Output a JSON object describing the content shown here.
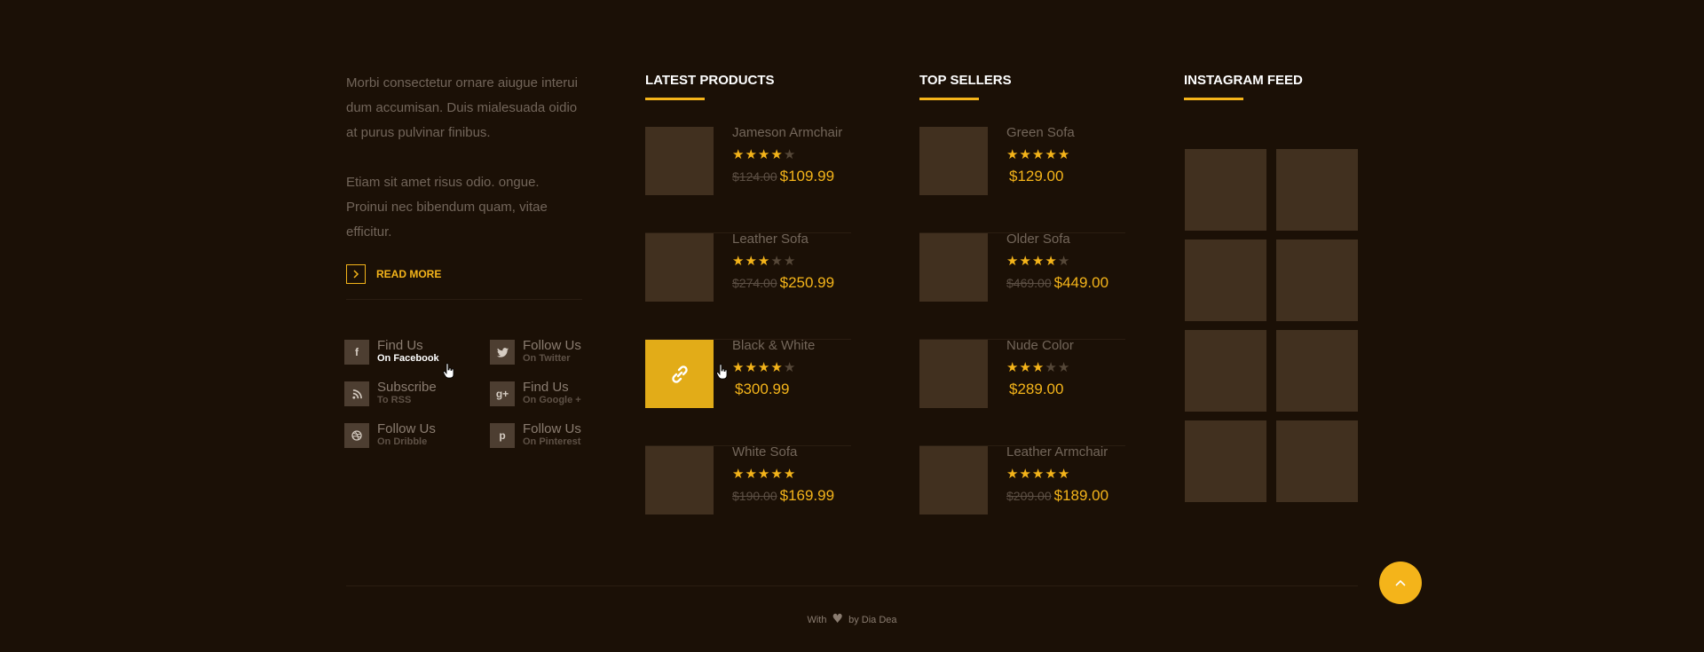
{
  "about": {
    "paragraph1": "Morbi consectetur ornare aiugue interui dum accumisan. Duis mialesuada oidio at purus pulvinar finibus.",
    "paragraph2": "Etiam sit amet risus odio. ongue. Proinui nec bibendum quam, vitae efficitur.",
    "read_more_label": "READ MORE",
    "read_more_icon": "chevron-right-icon"
  },
  "socials": [
    {
      "name": "facebook",
      "line1": "Find Us",
      "line2": "On Facebook",
      "icon": "facebook-icon",
      "glyph": "f"
    },
    {
      "name": "twitter",
      "line1": "Follow Us",
      "line2": "On Twitter",
      "icon": "twitter-icon",
      "glyph": ""
    },
    {
      "name": "rss",
      "line1": "Subscribe",
      "line2": "To RSS",
      "icon": "rss-icon",
      "glyph": ""
    },
    {
      "name": "google-plus",
      "line1": "Find Us",
      "line2": "On Google +",
      "icon": "google-plus-icon",
      "glyph": "g+"
    },
    {
      "name": "dribbble",
      "line1": "Follow Us",
      "line2": "On Dribble",
      "icon": "dribbble-icon",
      "glyph": ""
    },
    {
      "name": "pinterest",
      "line1": "Follow Us",
      "line2": "On Pinterest",
      "icon": "pinterest-icon",
      "glyph": "p"
    }
  ],
  "latest_products": {
    "title": "LATEST PRODUCTS",
    "items": [
      {
        "name": "Jameson Armchair",
        "rating": 4,
        "old_price": "$124.00",
        "price": "$109.99"
      },
      {
        "name": "Leather Sofa",
        "rating": 3,
        "old_price": "$274.00",
        "price": "$250.99"
      },
      {
        "name": "Black & White",
        "rating": 4,
        "old_price": "",
        "price": "$300.99",
        "hover_icon": "link-icon"
      },
      {
        "name": "White Sofa",
        "rating": 5,
        "old_price": "$190.00",
        "price": "$169.99"
      }
    ]
  },
  "top_sellers": {
    "title": "TOP SELLERS",
    "items": [
      {
        "name": "Green Sofa",
        "rating": 5,
        "old_price": "",
        "price": "$129.00"
      },
      {
        "name": "Older Sofa",
        "rating": 4,
        "old_price": "$469.00",
        "price": "$449.00"
      },
      {
        "name": "Nude Color",
        "rating": 3,
        "old_price": "",
        "price": "$289.00"
      },
      {
        "name": "Leather Armchair",
        "rating": 5,
        "old_price": "$209.00",
        "price": "$189.00"
      }
    ]
  },
  "instagram": {
    "title": "INSTAGRAM FEED",
    "tile_count": 8
  },
  "footer": {
    "credit_prefix": "With",
    "credit_icon": "heart-icon",
    "credit_suffix": "by Dia Dea",
    "to_top_icon": "chevron-up-icon"
  },
  "colors": {
    "background": "#1b1006",
    "accent": "#f4b41a",
    "thumb": "#41301f",
    "muted_text": "#73665a"
  }
}
